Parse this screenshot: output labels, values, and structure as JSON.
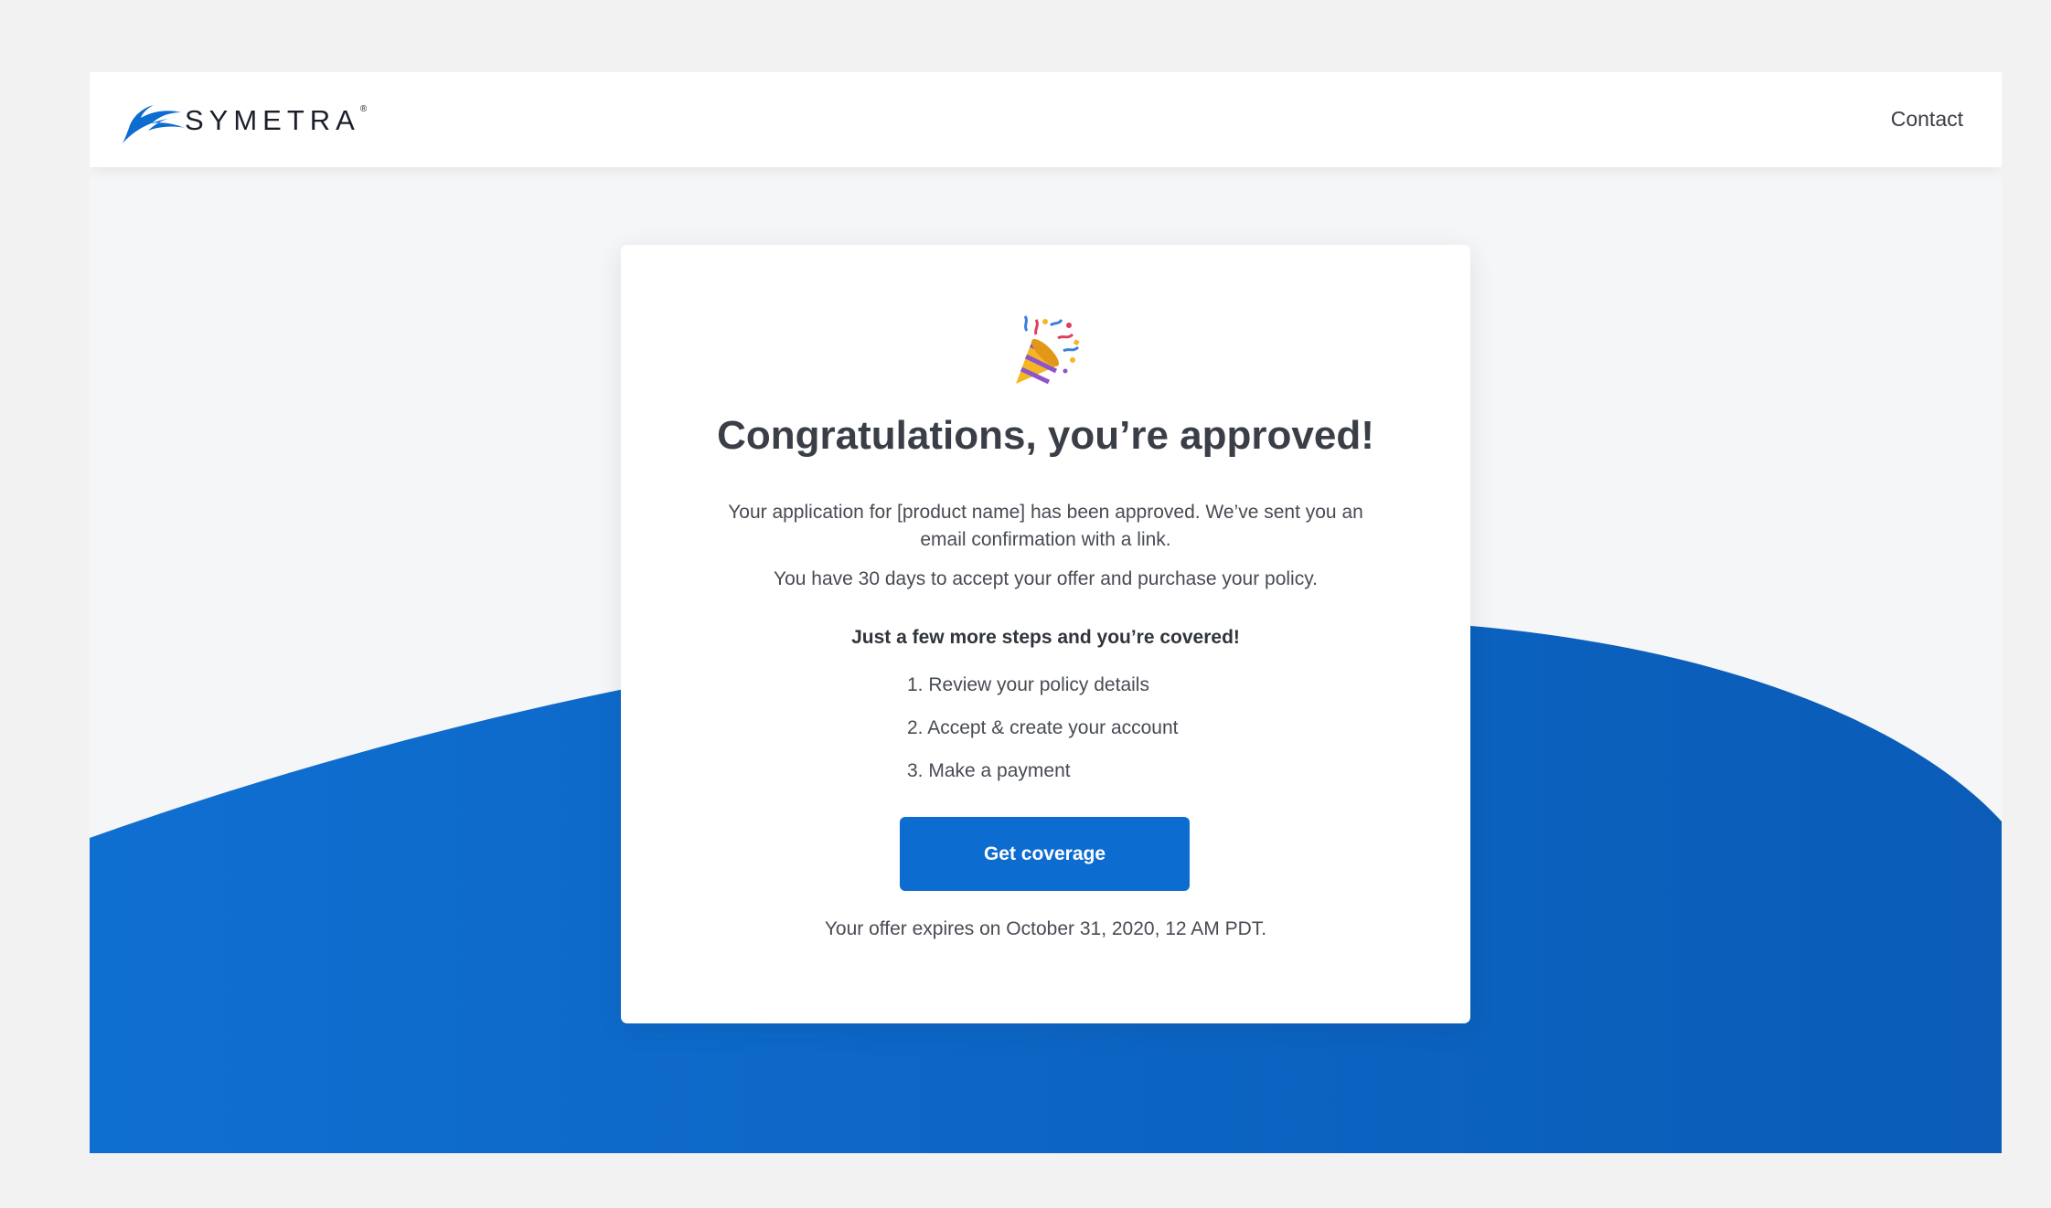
{
  "brand": {
    "name": "SYMETRA",
    "reg": "®",
    "color": "#0d6cd0"
  },
  "nav": {
    "contact_label": "Contact"
  },
  "card": {
    "icon": "party-popper-icon",
    "title": "Congratulations, you’re approved!",
    "message_1": "Your application for [product name] has been approved. We’ve sent you an email confirmation with a link.",
    "message_2": "You have 30 days to accept your offer and purchase your policy.",
    "steps_heading": "Just a few more steps and you’re covered!",
    "steps": [
      "1. Review your policy details",
      "2. Accept & create your account",
      "3. Make a payment"
    ],
    "cta_label": "Get coverage",
    "expires_text": "Your offer expires on October 31, 2020, 12 AM PDT."
  },
  "colors": {
    "accent": "#0d6cd0",
    "wave_dark": "#0a5bb5",
    "background": "#f5f6f8"
  }
}
